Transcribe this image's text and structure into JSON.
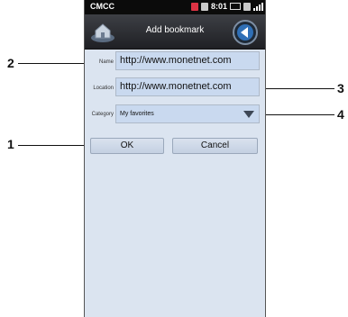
{
  "status_bar": {
    "carrier": "CMCC",
    "time": "8:01"
  },
  "title_bar": {
    "title": "Add bookmark"
  },
  "form": {
    "name_label": "Name",
    "name_value": "http://www.monetnet.com",
    "location_label": "Location",
    "location_value": "http://www.monetnet.com",
    "category_label": "Category",
    "category_value": "My favorites"
  },
  "buttons": {
    "ok": "OK",
    "cancel": "Cancel"
  },
  "callouts": {
    "c1": "1",
    "c2": "2",
    "c3": "3",
    "c4": "4"
  },
  "icons": [
    "home-icon",
    "back-arrow-icon",
    "dropdown-arrow-icon",
    "signal-icon",
    "battery-icon"
  ]
}
